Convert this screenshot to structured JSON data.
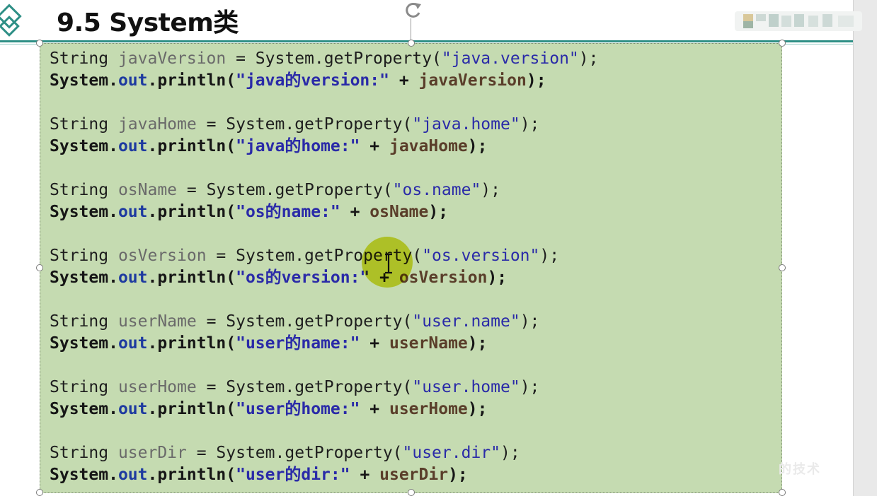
{
  "slide": {
    "title": "9.5 System类",
    "watermark": "的技术"
  },
  "code": {
    "blocks": [
      {
        "var": "javaVersion",
        "key": "java.version",
        "label": "java的version:"
      },
      {
        "var": "javaHome",
        "key": "java.home",
        "label": "java的home:"
      },
      {
        "var": "osName",
        "key": "os.name",
        "label": "os的name:"
      },
      {
        "var": "osVersion",
        "key": "os.version",
        "label": "os的version:"
      },
      {
        "var": "userName",
        "key": "user.name",
        "label": "user的name:"
      },
      {
        "var": "userHome",
        "key": "user.home",
        "label": "user的home:"
      },
      {
        "var": "userDir",
        "key": "user.dir",
        "label": "user的dir:"
      }
    ],
    "tokens": {
      "string_type": "String ",
      "assign": " = ",
      "system_get": "System.getProperty(",
      "quote": "\"",
      "close": ");",
      "system": "System.",
      "out": "out",
      "println": ".println(",
      "concat": " + ",
      "close_paren": ");"
    }
  },
  "colors": {
    "code_background": "#c5dbb1",
    "title_rule": "#2e8f86",
    "string": "#2a2aa8",
    "highlight": "#dada14"
  },
  "icons": [
    "diamond-logo-icon",
    "rotate-handle-icon",
    "text-cursor-icon"
  ]
}
